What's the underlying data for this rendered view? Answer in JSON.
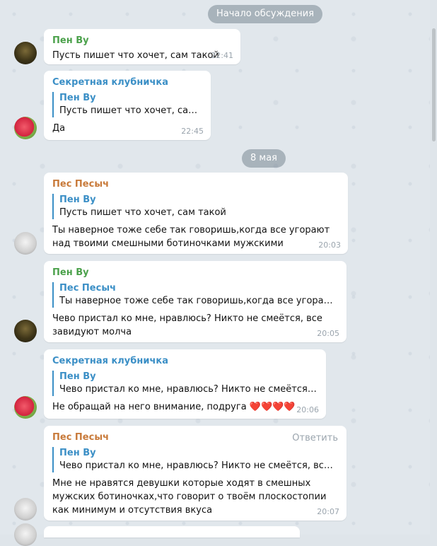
{
  "header": {
    "start_label": "Начало обсуждения"
  },
  "separators": {
    "date_label": "8 мая"
  },
  "actions": {
    "reply_label": "Ответить"
  },
  "messages": [
    {
      "author": "Пен Ву",
      "text": "Пусть пишет что хочет, сам такой",
      "time": "22:41"
    },
    {
      "author": "Секретная клубничка",
      "reply_author": "Пен Ву",
      "reply_text": "Пусть пишет что хочет, сам та...",
      "text": "Да",
      "time": "22:45"
    },
    {
      "author": "Пес Песыч",
      "reply_author": "Пен Ву",
      "reply_text": "Пусть пишет что хочет, сам такой",
      "text": "Ты наверное тоже себе так говоришь,когда все угорают над твоими смешными ботиночками мужскими",
      "time": "20:03"
    },
    {
      "author": "Пен Ву",
      "reply_author": "Пес Песыч",
      "reply_text": "Ты наверное тоже себе так говоришь,когда все угорают над ...",
      "text": "Чево пристал ко мне, нравлюсь? Никто не смеётся, все завидуют молча",
      "time": "20:05"
    },
    {
      "author": "Секретная клубничка",
      "reply_author": "Пен Ву",
      "reply_text": "Чево пристал ко мне, нравлюсь? Никто не смеётся, все зв...",
      "text": "Не обращай на него внимание, подруга",
      "emoji": "❤️❤️❤️❤️",
      "time": "20:06"
    },
    {
      "author": "Пес Песыч",
      "reply_author": "Пен Ву",
      "reply_text": "Чево пристал ко мне, нравлюсь? Никто не смеётся, все завид...",
      "text": "Мне не нравятся девушки которые ходят в смешных мужских ботиночках,что говорит о твоём плоскостопии как минимум и отсутствия вкуса",
      "time": "20:07"
    }
  ],
  "colors": {
    "green_author": "#4ba14b",
    "blue_author": "#3b8fc6",
    "orange_author": "#c87a3a",
    "pill_bg": "#7a8794"
  }
}
